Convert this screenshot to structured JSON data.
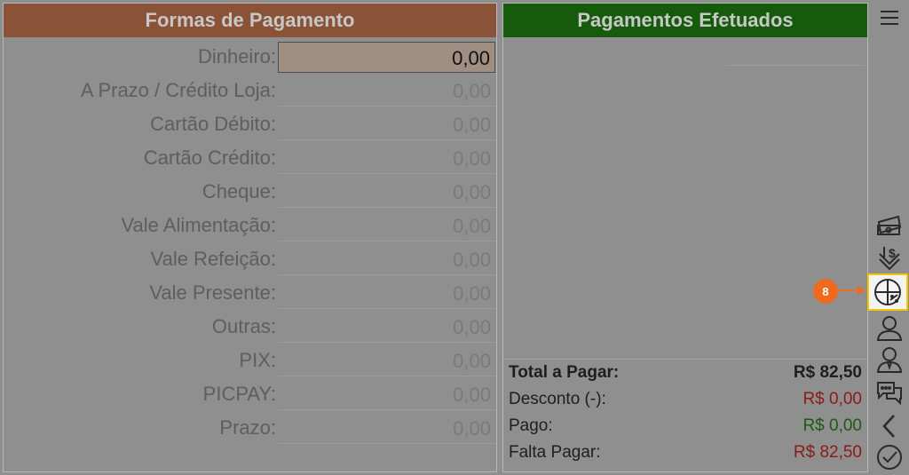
{
  "formas": {
    "title": "Formas de Pagamento",
    "rows": [
      {
        "label": "Dinheiro:",
        "value": "0,00"
      },
      {
        "label": "A Prazo / Crédito Loja:",
        "value": "0,00"
      },
      {
        "label": "Cartão Débito:",
        "value": "0,00"
      },
      {
        "label": "Cartão Crédito:",
        "value": "0,00"
      },
      {
        "label": "Cheque:",
        "value": "0,00"
      },
      {
        "label": "Vale Alimentação:",
        "value": "0,00"
      },
      {
        "label": "Vale Refeição:",
        "value": "0,00"
      },
      {
        "label": "Vale Presente:",
        "value": "0,00"
      },
      {
        "label": "Outras:",
        "value": "0,00"
      },
      {
        "label": "PIX:",
        "value": "0,00"
      },
      {
        "label": "PICPAY:",
        "value": "0,00"
      },
      {
        "label": "Prazo:",
        "value": "0,00"
      }
    ]
  },
  "efetuados": {
    "title": "Pagamentos Efetuados",
    "total_label": "Total a Pagar:",
    "total_value": "R$ 82,50",
    "desconto_label": "Desconto (-):",
    "desconto_value": "R$ 0,00",
    "pago_label": "Pago:",
    "pago_value": "R$ 0,00",
    "falta_label": "Falta Pagar:",
    "falta_value": "R$ 82,50"
  },
  "sidebar": {
    "icons": [
      "menu-icon",
      "cash-icon",
      "dollar-down-icon",
      "split-payment-icon",
      "customer-icon",
      "salesperson-icon",
      "chat-icon",
      "back-icon",
      "confirm-icon"
    ]
  },
  "callout": {
    "number": "8"
  },
  "colors": {
    "header_left": "#8a5236",
    "header_right": "#165a0c",
    "highlight": "#f6c700",
    "callout": "#ee6a1e"
  }
}
